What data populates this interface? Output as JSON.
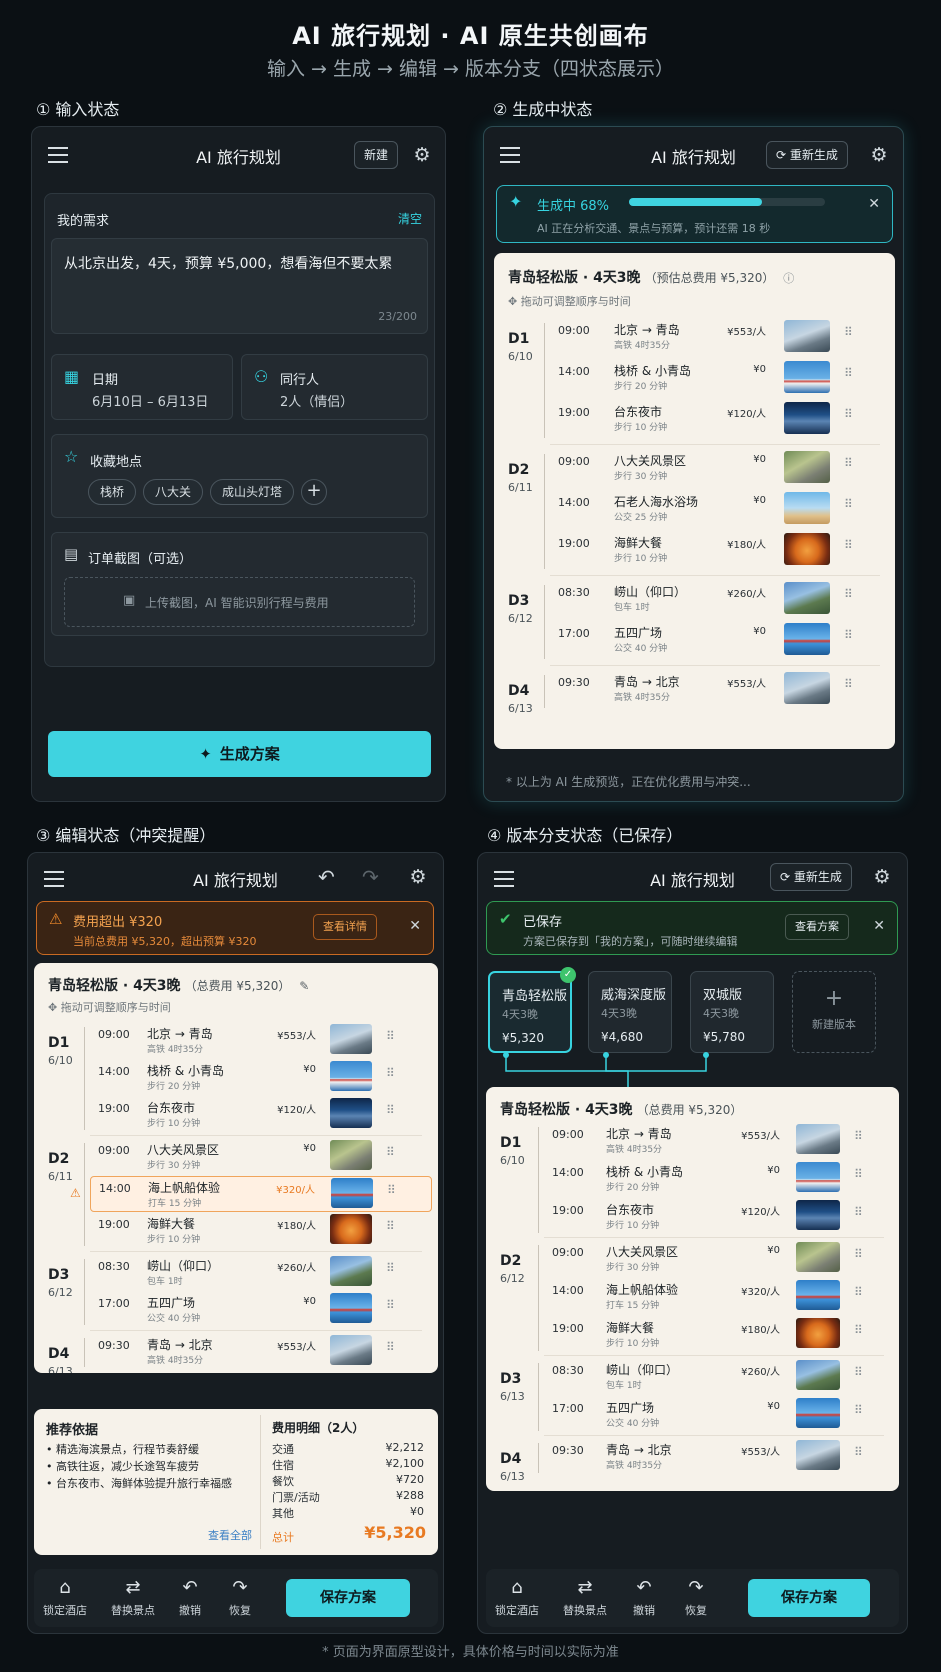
{
  "header": {
    "title": "AI 旅行规划 · AI 原生共创画布",
    "subtitle": "输入 → 生成 → 编辑 → 版本分支（四状态展示）"
  },
  "footer_note": "* 页面为界面原型设计，具体价格与时间以实际为准",
  "sections": {
    "s1": "① 输入状态",
    "s2": "② 生成中状态",
    "s3": "③ 编辑状态（冲突提醒）",
    "s4": "④ 版本分支状态（已保存）"
  },
  "app_title": "AI 旅行规划",
  "colors": {
    "accent": "#3fd3e0",
    "warning": "#e87a22",
    "success": "#3ec46d"
  },
  "input_state": {
    "new_label": "新建",
    "request_label": "我的需求",
    "clear_label": "清空",
    "request_text": "从北京出发，4天，预算 ¥5,000，想看海但不要太累",
    "char_count": "23/200",
    "date_label": "日期",
    "date_value": "6月10日 – 6月13日",
    "companions_label": "同行人",
    "companions_value": "2人（情侣）",
    "favorites_label": "收藏地点",
    "favorites": [
      "栈桥",
      "八大关",
      "成山头灯塔"
    ],
    "add_symbol": "+",
    "upload_label": "订单截图（可选）",
    "upload_hint": "上传截图，AI 智能识别行程与费用",
    "generate_label": "生成方案"
  },
  "generating_state": {
    "regen_label": "重新生成",
    "progress_label": "生成中 68%",
    "progress_pct": 68,
    "progress_detail": "AI 正在分析交通、景点与预算，预计还需 18 秒",
    "plan_title": "青岛轻松版 · 4天3晚",
    "plan_sub": "（预估总费用 ¥5,320）",
    "hint": "拖动可调整顺序与时间",
    "note": "* 以上为 AI 生成预览，正在优化费用与冲突..."
  },
  "editing_state": {
    "alert_title": "费用超出 ¥320",
    "alert_detail": "当前总费用 ¥5,320，超出预算 ¥320",
    "alert_btn": "查看详情",
    "plan_title": "青岛轻松版 · 4天3晚",
    "plan_sub": "（总费用 ¥5,320）",
    "hint": "拖动可调整顺序与时间",
    "reasons_title": "推荐依据",
    "reasons": [
      "精选海滨景点，行程节奏舒缓",
      "高铁往返，减少长途驾车疲劳",
      "台东夜市、海鲜体验提升旅行幸福感"
    ],
    "view_all": "查看全部",
    "cost_title": "费用明细（2人）",
    "costs": [
      {
        "k": "交通",
        "v": "¥2,212"
      },
      {
        "k": "住宿",
        "v": "¥2,100"
      },
      {
        "k": "餐饮",
        "v": "¥720"
      },
      {
        "k": "门票/活动",
        "v": "¥288"
      },
      {
        "k": "其他",
        "v": "¥0"
      }
    ],
    "total_label": "总计",
    "total_value": "¥5,320"
  },
  "branch_state": {
    "regen_label": "重新生成",
    "saved_title": "已保存",
    "saved_detail": "方案已保存到「我的方案」，可随时继续编辑",
    "view_btn": "查看方案",
    "versions": [
      {
        "name": "青岛轻松版",
        "days": "4天3晚",
        "price": "¥5,320"
      },
      {
        "name": "威海深度版",
        "days": "4天3晚",
        "price": "¥4,680"
      },
      {
        "name": "双城版",
        "days": "4天3晚",
        "price": "¥5,780"
      }
    ],
    "new_version_label": "新建版本",
    "new_version_symbol": "+",
    "plan_title": "青岛轻松版 · 4天3晚",
    "plan_sub": "（总费用 ¥5,320）"
  },
  "toolbar": {
    "lock_hotel": "锁定酒店",
    "replace_spot": "替换景点",
    "undo": "撤销",
    "redo": "恢复",
    "save": "保存方案"
  },
  "itinerary_a": [
    {
      "day": "D1",
      "date": "6/10",
      "items": [
        {
          "time": "09:00",
          "name": "北京 → 青岛",
          "transport": "高铁 4时35分",
          "price": "¥553/人",
          "img": "a"
        },
        {
          "time": "14:00",
          "name": "栈桥 & 小青岛",
          "transport": "步行 20 分钟",
          "price": "¥0",
          "img": "b"
        },
        {
          "time": "19:00",
          "name": "台东夜市",
          "transport": "步行 10 分钟",
          "price": "¥120/人",
          "img": "c"
        }
      ]
    },
    {
      "day": "D2",
      "date": "6/11",
      "items": [
        {
          "time": "09:00",
          "name": "八大关风景区",
          "transport": "步行 30 分钟",
          "price": "¥0",
          "img": "d"
        },
        {
          "time": "14:00",
          "name": "石老人海水浴场",
          "transport": "公交 25 分钟",
          "price": "¥0",
          "img": "e"
        },
        {
          "time": "19:00",
          "name": "海鲜大餐",
          "transport": "步行 10 分钟",
          "price": "¥180/人",
          "img": "f"
        }
      ]
    },
    {
      "day": "D3",
      "date": "6/12",
      "items": [
        {
          "time": "08:30",
          "name": "崂山（仰口）",
          "transport": "包车 1时",
          "price": "¥260/人",
          "img": "g"
        },
        {
          "time": "17:00",
          "name": "五四广场",
          "transport": "公交 40 分钟",
          "price": "¥0",
          "img": "h"
        }
      ]
    },
    {
      "day": "D4",
      "date": "6/13",
      "items": [
        {
          "time": "09:30",
          "name": "青岛 → 北京",
          "transport": "高铁 4时35分",
          "price": "¥553/人",
          "img": "a"
        }
      ]
    }
  ],
  "itinerary_b": [
    {
      "day": "D1",
      "date": "6/10",
      "items": [
        {
          "time": "09:00",
          "name": "北京 → 青岛",
          "transport": "高铁 4时35分",
          "price": "¥553/人",
          "img": "a"
        },
        {
          "time": "14:00",
          "name": "栈桥 & 小青岛",
          "transport": "步行 20 分钟",
          "price": "¥0",
          "img": "b"
        },
        {
          "time": "19:00",
          "name": "台东夜市",
          "transport": "步行 10 分钟",
          "price": "¥120/人",
          "img": "c"
        }
      ]
    },
    {
      "day": "D2",
      "date": "6/11",
      "items": [
        {
          "time": "09:00",
          "name": "八大关风景区",
          "transport": "步行 30 分钟",
          "price": "¥0",
          "img": "d"
        },
        {
          "time": "14:00",
          "name": "海上帆船体验",
          "transport": "打车 15 分钟",
          "price": "¥320/人",
          "img": "h",
          "warn": true
        },
        {
          "time": "19:00",
          "name": "海鲜大餐",
          "transport": "步行 10 分钟",
          "price": "¥180/人",
          "img": "f"
        }
      ]
    },
    {
      "day": "D3",
      "date": "6/12",
      "items": [
        {
          "time": "08:30",
          "name": "崂山（仰口）",
          "transport": "包车 1时",
          "price": "¥260/人",
          "img": "g"
        },
        {
          "time": "17:00",
          "name": "五四广场",
          "transport": "公交 40 分钟",
          "price": "¥0",
          "img": "h"
        }
      ]
    },
    {
      "day": "D4",
      "date": "6/13",
      "items": [
        {
          "time": "09:30",
          "name": "青岛 → 北京",
          "transport": "高铁 4时35分",
          "price": "¥553/人",
          "img": "a"
        }
      ]
    }
  ],
  "itinerary_c": [
    {
      "day": "D1",
      "date": "6/10",
      "items": [
        {
          "time": "09:00",
          "name": "北京 → 青岛",
          "transport": "高铁 4时35分",
          "price": "¥553/人",
          "img": "a"
        },
        {
          "time": "14:00",
          "name": "栈桥 & 小青岛",
          "transport": "步行 20 分钟",
          "price": "¥0",
          "img": "b"
        },
        {
          "time": "19:00",
          "name": "台东夜市",
          "transport": "步行 10 分钟",
          "price": "¥120/人",
          "img": "c"
        }
      ]
    },
    {
      "day": "D2",
      "date": "6/12",
      "items": [
        {
          "time": "09:00",
          "name": "八大关风景区",
          "transport": "步行 30 分钟",
          "price": "¥0",
          "img": "d"
        },
        {
          "time": "14:00",
          "name": "海上帆船体验",
          "transport": "打车 15 分钟",
          "price": "¥320/人",
          "img": "h"
        },
        {
          "time": "19:00",
          "name": "海鲜大餐",
          "transport": "步行 10 分钟",
          "price": "¥180/人",
          "img": "f"
        }
      ]
    },
    {
      "day": "D3",
      "date": "6/13",
      "items": [
        {
          "time": "08:30",
          "name": "崂山（仰口）",
          "transport": "包车 1时",
          "price": "¥260/人",
          "img": "g"
        },
        {
          "time": "17:00",
          "name": "五四广场",
          "transport": "公交 40 分钟",
          "price": "¥0",
          "img": "h"
        }
      ]
    },
    {
      "day": "D4",
      "date": "6/13",
      "items": [
        {
          "time": "09:30",
          "name": "青岛 → 北京",
          "transport": "高铁 4时35分",
          "price": "¥553/人",
          "img": "a"
        }
      ]
    }
  ]
}
